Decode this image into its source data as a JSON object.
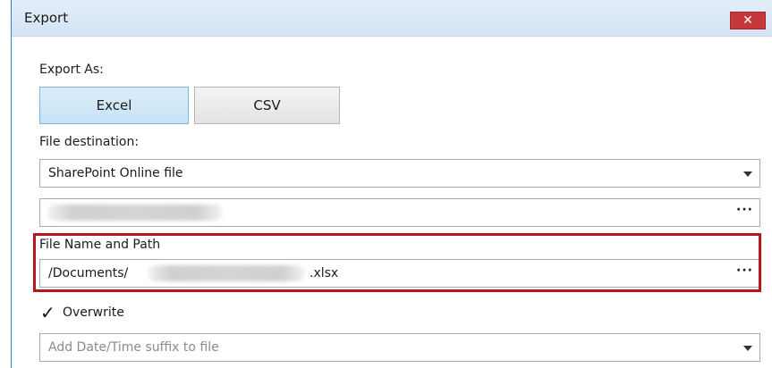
{
  "window": {
    "title": "Export",
    "close_glyph": "✕"
  },
  "export_as": {
    "label": "Export As:",
    "options": [
      "Excel",
      "CSV"
    ],
    "selected": "Excel"
  },
  "file_destination": {
    "label": "File destination:",
    "value": "SharePoint Online file"
  },
  "site_field": {
    "ellipsis": "···"
  },
  "file_name_path": {
    "label": "File Name and Path",
    "prefix": "/Documents/",
    "suffix": ".xlsx",
    "ellipsis": "···"
  },
  "overwrite": {
    "label": "Overwrite",
    "checked": true,
    "check_glyph": "✓"
  },
  "suffix_dropdown": {
    "placeholder": "Add Date/Time suffix to file"
  },
  "colors": {
    "highlight_border": "#b3191c",
    "close_button": "#c7383b",
    "selected_button": "#c6e2f7",
    "window_border": "#2f86d6"
  },
  "icons": [
    "close-icon",
    "dropdown-arrow-icon",
    "ellipsis-icon",
    "checkmark-icon"
  ]
}
